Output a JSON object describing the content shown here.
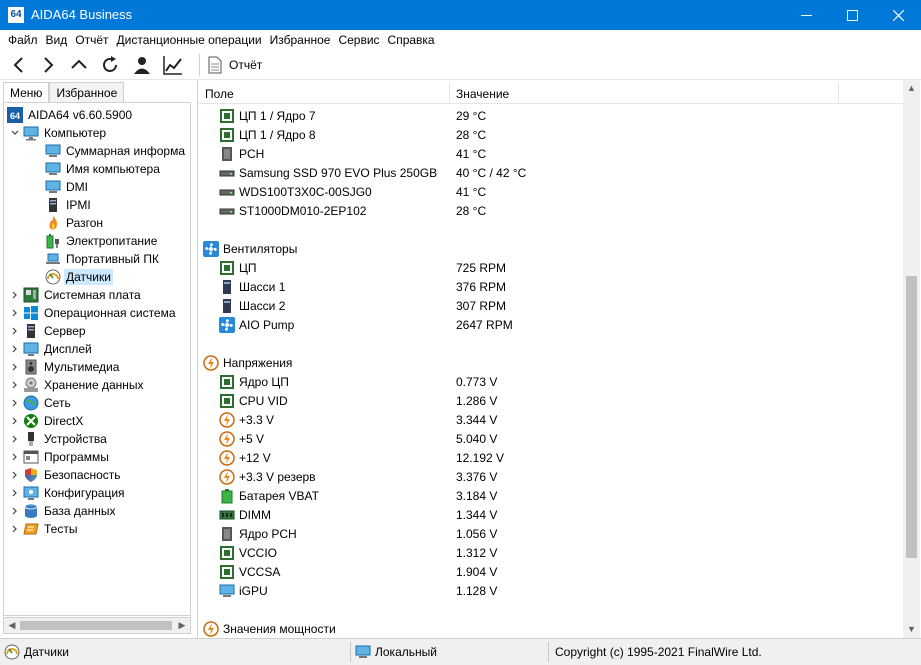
{
  "window": {
    "icon_text": "64",
    "title": "AIDA64 Business"
  },
  "menu": [
    "Файл",
    "Вид",
    "Отчёт",
    "Дистанционные операции",
    "Избранное",
    "Сервис",
    "Справка"
  ],
  "toolbar": {
    "report_label": "Отчёт"
  },
  "tabs": {
    "menu": "Меню",
    "favorites": "Избранное"
  },
  "tree": {
    "root": "AIDA64 v6.60.5900",
    "computer": "Компьютер",
    "computer_children": [
      "Суммарная информа",
      "Имя компьютера",
      "DMI",
      "IPMI",
      "Разгон",
      "Электропитание",
      "Портативный ПК",
      "Датчики"
    ],
    "categories": [
      "Системная плата",
      "Операционная система",
      "Сервер",
      "Дисплей",
      "Мультимедиа",
      "Хранение данных",
      "Сеть",
      "DirectX",
      "Устройства",
      "Программы",
      "Безопасность",
      "Конфигурация",
      "База данных",
      "Тесты"
    ]
  },
  "columns": {
    "field": "Поле",
    "value": "Значение"
  },
  "temps": [
    {
      "field": "ЦП 1 / Ядро 7",
      "value": "29 °C"
    },
    {
      "field": "ЦП 1 / Ядро 8",
      "value": "28 °C"
    },
    {
      "field": "PCH",
      "value": "41 °C"
    },
    {
      "field": "Samsung SSD 970 EVO Plus 250GB",
      "value": "40 °C / 42 °C"
    },
    {
      "field": "WDS100T3X0C-00SJG0",
      "value": "41 °C"
    },
    {
      "field": "ST1000DM010-2EP102",
      "value": "28 °C"
    }
  ],
  "fans_section": "Вентиляторы",
  "fans": [
    {
      "field": "ЦП",
      "value": "725 RPM"
    },
    {
      "field": "Шасси 1",
      "value": "376 RPM"
    },
    {
      "field": "Шасси 2",
      "value": "307 RPM"
    },
    {
      "field": "AIO Pump",
      "value": "2647 RPM"
    }
  ],
  "volt_section": "Напряжения",
  "volts": [
    {
      "field": "Ядро ЦП",
      "value": "0.773 V"
    },
    {
      "field": "CPU VID",
      "value": "1.286 V"
    },
    {
      "field": "+3.3 V",
      "value": "3.344 V"
    },
    {
      "field": "+5 V",
      "value": "5.040 V"
    },
    {
      "field": "+12 V",
      "value": "12.192 V"
    },
    {
      "field": "+3.3 V резерв",
      "value": "3.376 V"
    },
    {
      "field": "Батарея VBAT",
      "value": "3.184 V"
    },
    {
      "field": "DIMM",
      "value": "1.344 V"
    },
    {
      "field": "Ядро PCH",
      "value": "1.056 V"
    },
    {
      "field": "VCCIO",
      "value": "1.312 V"
    },
    {
      "field": "VCCSA",
      "value": "1.904 V"
    },
    {
      "field": "iGPU",
      "value": "1.128 V"
    }
  ],
  "power_section": "Значения мощности",
  "status": {
    "left": "Датчики",
    "middle": "Локальный",
    "right": "Copyright (c) 1995-2021 FinalWire Ltd."
  },
  "colors": {
    "titlebar": "#0078d7",
    "selection": "#cce8ff"
  }
}
